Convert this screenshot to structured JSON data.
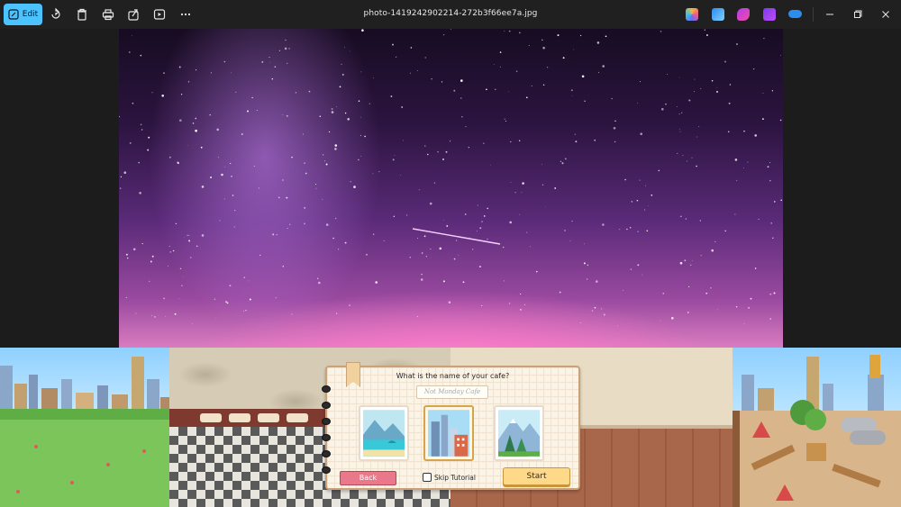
{
  "titlebar": {
    "edit_label": "Edit",
    "file_name": "photo-1419242902214-272b3f66ee7a.jpg",
    "tools": [
      "rotate-icon",
      "delete-icon",
      "print-icon",
      "share-icon",
      "slideshow-icon",
      "more-icon"
    ],
    "app_icons": [
      "copilot-icon",
      "photos-icon",
      "designer-icon",
      "clipchamp-icon",
      "onedrive-icon"
    ],
    "window_controls": [
      "minimize-icon",
      "restore-icon",
      "close-icon"
    ],
    "accent": "#4cc2ff"
  },
  "photo": {
    "subject": "starry-night-sky",
    "colors": {
      "top": "#170c22",
      "mid": "#5a2a78",
      "bottom": "#d97cc0"
    }
  },
  "game": {
    "dialog": {
      "question": "What is the name of your cafe?",
      "name_placeholder": "Not Monday Cafe",
      "locations": [
        {
          "name": "beach-location",
          "selected": false
        },
        {
          "name": "city-location",
          "selected": true
        },
        {
          "name": "mountain-location",
          "selected": false
        }
      ],
      "back_label": "Back",
      "skip_label": "Skip Tutorial",
      "skip_checked": false,
      "start_label": "Start"
    }
  }
}
